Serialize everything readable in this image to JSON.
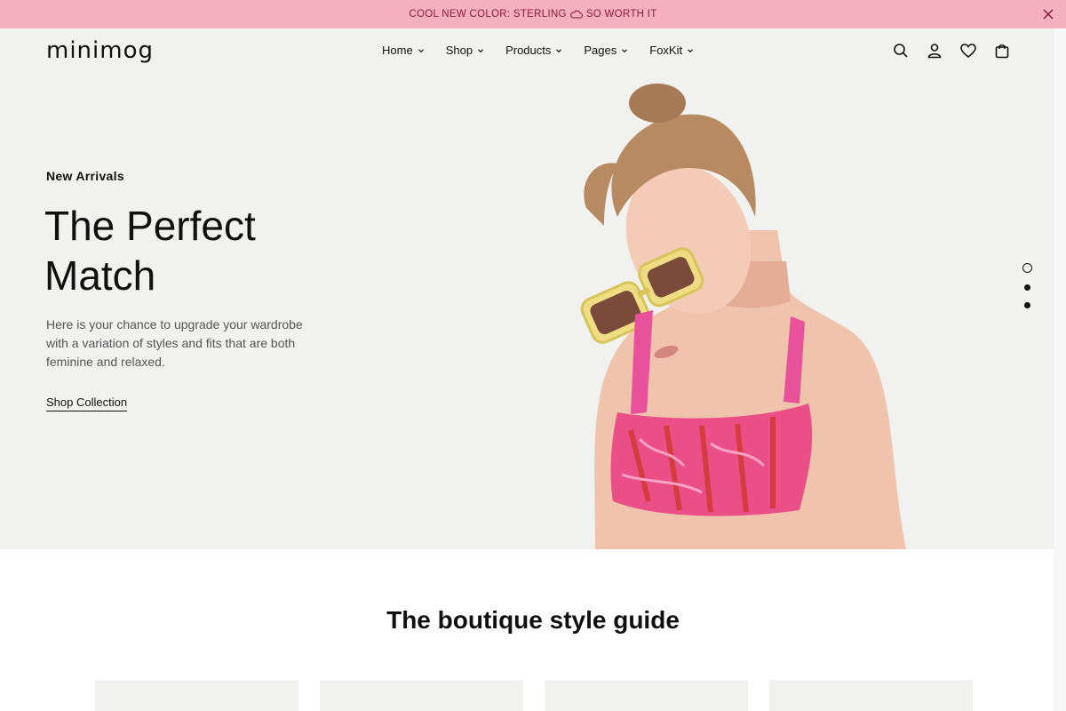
{
  "announcement": {
    "text_before": "COOL NEW COLOR: STERLING",
    "text_after": "SO WORTH IT",
    "icon": "cloud-icon"
  },
  "header": {
    "logo": "minimog",
    "nav": [
      {
        "label": "Home"
      },
      {
        "label": "Shop"
      },
      {
        "label": "Products"
      },
      {
        "label": "Pages"
      },
      {
        "label": "FoxKit"
      }
    ],
    "icons": [
      "search-icon",
      "account-icon",
      "wishlist-icon",
      "cart-icon"
    ]
  },
  "hero": {
    "kicker": "New Arrivals",
    "title": "The Perfect Match",
    "description": "Here is your chance to upgrade your wardrobe with a variation of styles and fits that are both feminine and relaxed.",
    "cta": "Shop Collection",
    "slides": 3,
    "active_slide": 1
  },
  "section": {
    "title": "The boutique style guide"
  },
  "colors": {
    "announce_bg": "#f4b0bb",
    "hero_bg": "#f1f1f0",
    "text": "#111111"
  }
}
